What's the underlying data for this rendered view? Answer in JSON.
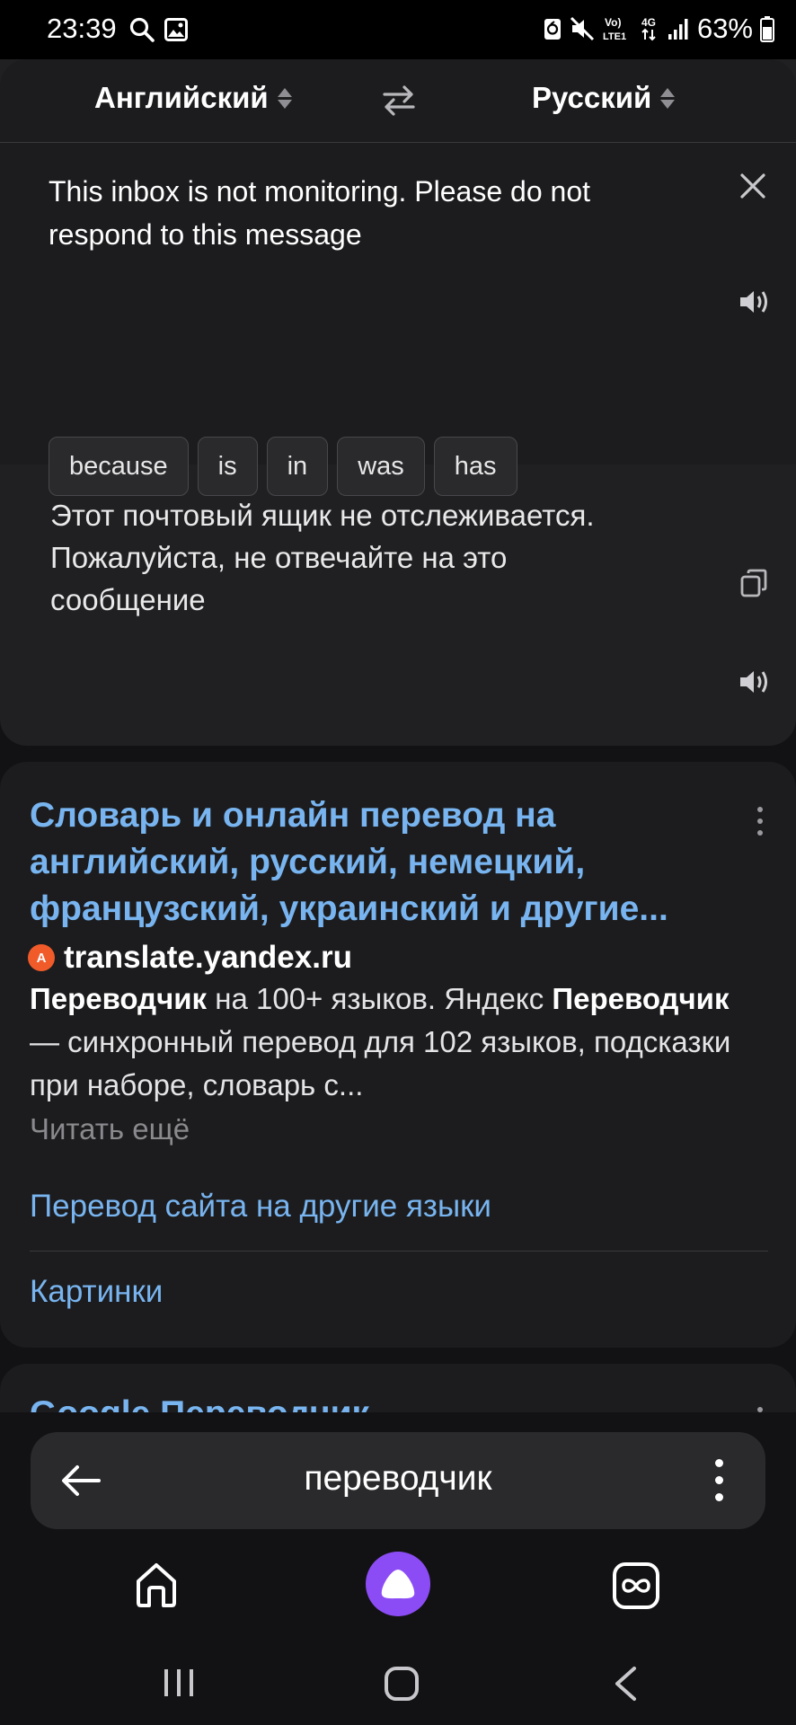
{
  "status_bar": {
    "time": "23:39",
    "battery": "63%",
    "icons": [
      "search-icon",
      "gallery-icon",
      "data-saver-icon",
      "mute-icon",
      "volte-icon",
      "4g-icon",
      "signal-icon",
      "battery-icon"
    ],
    "volte_label": "Vo)\nLTE1",
    "network": "4G"
  },
  "translator": {
    "source_lang": "Английский",
    "target_lang": "Русский",
    "source_text": "This inbox is not monitoring. Please do not respond to this message",
    "suggestions": [
      "because",
      "is",
      "in",
      "was",
      "has"
    ],
    "translation": "Этот почтовый ящик не отслеживается. Пожалуйста, не отвечайте на это сообщение"
  },
  "result": {
    "title": "Словарь и онлайн перевод на английский, русский, немецкий, французский, украинский и другие...",
    "site_logo_text": "A",
    "site": "translate.yandex.ru",
    "snippet_bold_1": "Переводчик",
    "snippet_part_1": " на 100+ языков. Яндекс ",
    "snippet_bold_2": "Переводчик",
    "snippet_part_2": " — синхронный перевод для 102 языков, подсказки при наборе, словарь с...",
    "read_more": "Читать ещё",
    "sublink_1": "Перевод сайта на другие языки",
    "sublink_2": "Картинки"
  },
  "next_result": {
    "title_partial": "Google Переводчик"
  },
  "search_bar": {
    "query": "переводчик"
  },
  "colors": {
    "link": "#78b4ef",
    "alice": "#8c4cf5",
    "background": "#121214",
    "card": "#1c1c1e"
  }
}
